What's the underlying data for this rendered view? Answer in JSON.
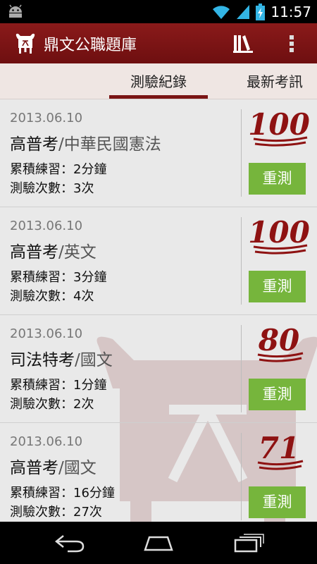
{
  "status_bar": {
    "time": "11:57",
    "icons": [
      "android-icon",
      "wifi-icon",
      "signal-icon",
      "battery-charging-icon"
    ]
  },
  "action_bar": {
    "title": "鼎文公職題庫",
    "icons": [
      "app-logo-icon",
      "library-icon",
      "overflow-menu-icon"
    ]
  },
  "tabs": [
    {
      "label": "測驗紀錄",
      "active": true
    },
    {
      "label": "最新考訊",
      "active": false
    }
  ],
  "records": [
    {
      "date": "2013.06.10",
      "exam": "高普考",
      "separator": "/",
      "subject": "中華民國憲法",
      "practice": "累積練習：2分鐘",
      "attempts": "測驗次數：3次",
      "score": "100",
      "button": "重測"
    },
    {
      "date": "2013.06.10",
      "exam": "高普考",
      "separator": "/",
      "subject": "英文",
      "practice": "累積練習：3分鐘",
      "attempts": "測驗次數：4次",
      "score": "100",
      "button": "重測"
    },
    {
      "date": "2013.06.10",
      "exam": "司法特考",
      "separator": "/",
      "subject": "國文",
      "practice": "累積練習：1分鐘",
      "attempts": "測驗次數：2次",
      "score": "80",
      "button": "重測"
    },
    {
      "date": "2013.06.10",
      "exam": "高普考",
      "separator": "/",
      "subject": "國文",
      "practice": "累積練習：16分鐘",
      "attempts": "測驗次數：27次",
      "score": "71",
      "button": "重測"
    }
  ],
  "nav_bar": {
    "icons": [
      "back-icon",
      "home-icon",
      "recent-apps-icon"
    ]
  },
  "colors": {
    "action_bar": "#7a1414",
    "button": "#76b53c",
    "score": "#8e1212",
    "tab_bar": "#efe6e3",
    "list_bg": "#e9e9e9"
  }
}
